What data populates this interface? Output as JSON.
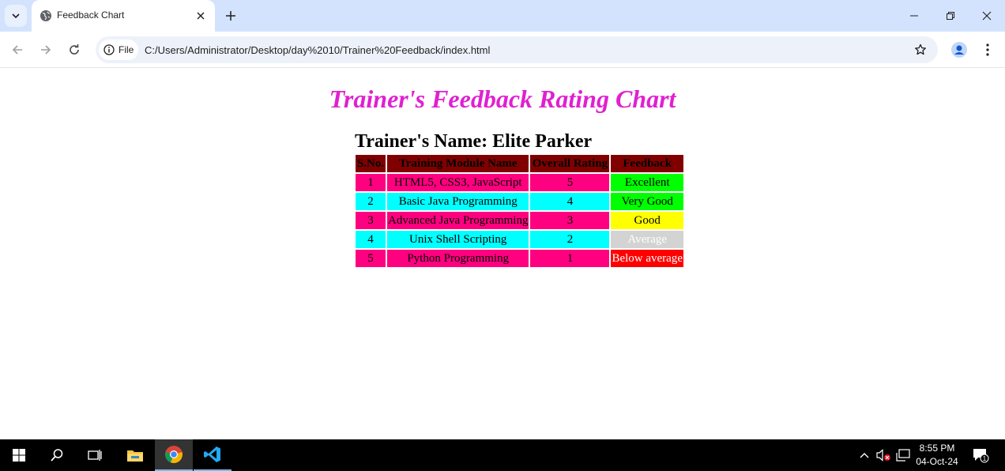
{
  "browser": {
    "tab_title": "Feedback Chart",
    "chip_label": "File",
    "url": "C:/Users/Administrator/Desktop/day%2010/Trainer%20Feedback/index.html"
  },
  "page": {
    "title": "Trainer's Feedback Rating Chart",
    "trainer_name": "Trainer's Name: Elite Parker",
    "table": {
      "headers": [
        "S.No.",
        "Training Module Name",
        "Overall Rating",
        "Feedback"
      ],
      "rows": [
        {
          "sno": "1",
          "module": "HTML5, CSS3, JavaScript",
          "rating": "5",
          "feedback": "Excellent",
          "feedback_bg": "#00ff00",
          "feedback_fg": "#000000"
        },
        {
          "sno": "2",
          "module": "Basic Java Programming",
          "rating": "4",
          "feedback": "Very Good",
          "feedback_bg": "#00ff00",
          "feedback_fg": "#000000"
        },
        {
          "sno": "3",
          "module": "Advanced Java Programming",
          "rating": "3",
          "feedback": "Good",
          "feedback_bg": "#ffff00",
          "feedback_fg": "#000000"
        },
        {
          "sno": "4",
          "module": "Unix Shell Scripting",
          "rating": "2",
          "feedback": "Average",
          "feedback_bg": "#d3d3d3",
          "feedback_fg": "#ffffff"
        },
        {
          "sno": "5",
          "module": "Python Programming",
          "rating": "1",
          "feedback": "Below average",
          "feedback_bg": "#ff0000",
          "feedback_fg": "#ffffff"
        }
      ]
    }
  },
  "colors": {
    "title": "#e020d0",
    "header_bg": "#800000",
    "row_pink": "#ff0080",
    "row_cyan": "#00ffff"
  },
  "taskbar": {
    "time": "8:55 PM",
    "date": "04-Oct-24",
    "notification_count": "1"
  }
}
